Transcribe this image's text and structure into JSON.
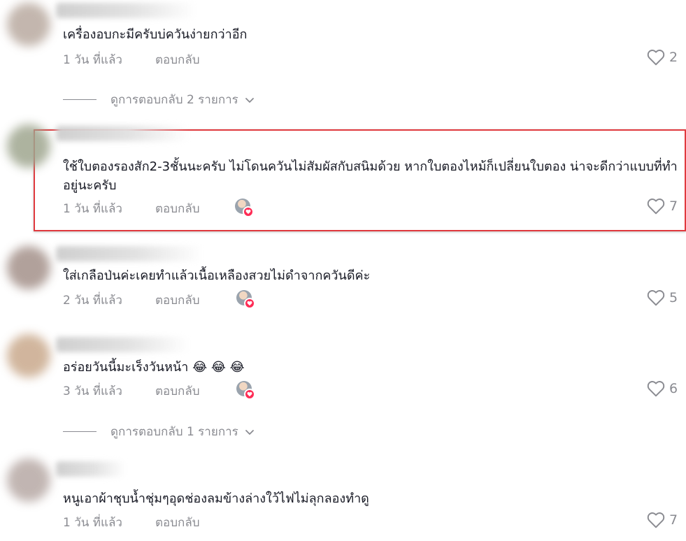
{
  "comments": [
    {
      "text": "เครื่องอบกะมีครับบ่ควันง่ายกว่าอีก",
      "time": "1 วัน ที่แล้ว",
      "reply_label": "ตอบกลับ",
      "likes": "2",
      "creator_liked": false,
      "avatar_color": "#b9aaa0"
    },
    {
      "text": "ใช้ใบตองรองสัก2-3ชั้นนะครับ ไม่โดนควันไม่สัมผัสกับสนิมด้วย หากใบตองไหม้ก็เปลี่ยนใบตอง น่าจะดีกว่าแบบที่ทำอยู่นะครับ",
      "time": "1 วัน ที่แล้ว",
      "reply_label": "ตอบกลับ",
      "likes": "7",
      "creator_liked": true,
      "highlighted": true,
      "avatar_color": "#9fa68f"
    },
    {
      "text": "ใส่เกลือป่นค่ะเคยทำแล้วเนื้อเหลืองสวยไม่ดำจากควันดีค่ะ",
      "time": "2 วัน ที่แล้ว",
      "reply_label": "ตอบกลับ",
      "likes": "5",
      "creator_liked": true,
      "avatar_color": "#a4918a"
    },
    {
      "text": "อร่อยวันนี้มะเร็งวันหน้า 😂 😂 😂",
      "time": "3 วัน ที่แล้ว",
      "reply_label": "ตอบกลับ",
      "likes": "6",
      "creator_liked": true,
      "avatar_color": "#c9a98c"
    },
    {
      "text": "หนูเอาผ้าชุบน้ำชุ่มๆอุดช่องลมข้างล่างใว้ไฟไม่ลุกลองทำดู",
      "time": "1 วัน ที่แล้ว",
      "reply_label": "ตอบกลับ",
      "likes": "7",
      "creator_liked": false,
      "avatar_color": "#b7a9a5"
    }
  ],
  "view_replies": [
    {
      "label": "ดูการตอบกลับ 2 รายการ"
    },
    {
      "label": "ดูการตอบกลับ 1 รายการ"
    }
  ],
  "colors": {
    "text": "#161823",
    "secondary": "#8a8b91",
    "highlight_border": "#e0393e",
    "heart_badge": "#fe2c55"
  },
  "icons": {
    "like": "heart-outline-icon",
    "expand": "chevron-down-icon",
    "creator_like": "heart-badge-icon"
  }
}
